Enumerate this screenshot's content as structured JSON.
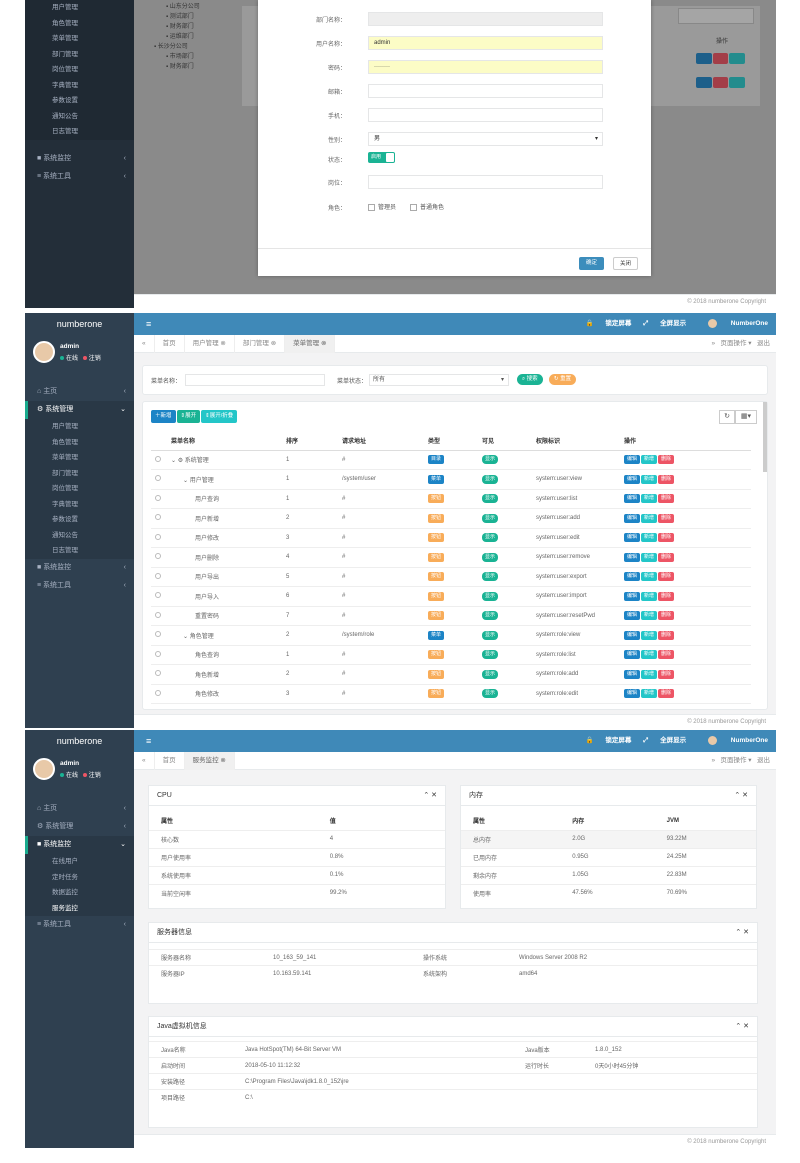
{
  "panel1": {
    "sidebar_items": [
      "用户管理",
      "角色管理",
      "菜单管理",
      "部门管理",
      "岗位管理",
      "字典管理",
      "参数设置",
      "通知公告",
      "日志管理"
    ],
    "nav": [
      {
        "label": "系统监控"
      },
      {
        "label": "系统工具"
      }
    ],
    "tree": [
      "山东分公司",
      "测试部门",
      "财务部门",
      "运维部门",
      "长沙分公司",
      "市场部门",
      "财务部门"
    ],
    "form": {
      "labels": [
        "部门名称：",
        "用户名称：",
        "密码：",
        "邮箱：",
        "手机：",
        "性别：",
        "状态：",
        "岗位：",
        "角色："
      ],
      "username_value": "admin",
      "password_value": "········",
      "gender_value": "男",
      "status_value": "启用",
      "role_options": [
        "管理员",
        "普通角色"
      ],
      "ok_label": "确定",
      "cancel_label": "关闭"
    },
    "toolbar_col": "操作",
    "footer": "© 2018 numberone Copyright"
  },
  "panel2": {
    "logo": "numberone",
    "top_links": [
      "锁定屏幕",
      "全屏显示",
      "NumberOne"
    ],
    "user": {
      "name": "admin",
      "status_online": "在线",
      "status_logout": "注销"
    },
    "nav": [
      {
        "label": "主页",
        "open": false
      },
      {
        "label": "系统管理",
        "open": true
      },
      {
        "label": "系统监控",
        "open": false
      },
      {
        "label": "系统工具",
        "open": false
      }
    ],
    "sub_items": [
      "用户管理",
      "角色管理",
      "菜单管理",
      "部门管理",
      "岗位管理",
      "字典管理",
      "参数设置",
      "通知公告",
      "日志管理"
    ],
    "tabs": [
      "首页",
      "用户管理",
      "部门管理",
      "菜单管理"
    ],
    "tab_right": [
      "页面操作",
      "退出"
    ],
    "search": {
      "name_label": "菜单名称：",
      "status_label": "菜单状态：",
      "status_value": "所有",
      "search_btn": "搜索",
      "reset_btn": "重置"
    },
    "actions": {
      "add": "新增",
      "expand": "展开",
      "collapse": "展开/折叠"
    },
    "columns": [
      "菜单名称",
      "排序",
      "请求地址",
      "类型",
      "可见",
      "权限标识",
      "操作"
    ],
    "rows": [
      {
        "name": "系统管理",
        "order": "1",
        "url": "#",
        "type": "目录",
        "visible": "显示",
        "perm": "",
        "level": 0
      },
      {
        "name": "用户管理",
        "order": "1",
        "url": "/system/user",
        "type": "菜单",
        "visible": "显示",
        "perm": "system:user:view",
        "level": 1
      },
      {
        "name": "用户查询",
        "order": "1",
        "url": "#",
        "type": "按钮",
        "visible": "显示",
        "perm": "system:user:list",
        "level": 2
      },
      {
        "name": "用户新增",
        "order": "2",
        "url": "#",
        "type": "按钮",
        "visible": "显示",
        "perm": "system:user:add",
        "level": 2
      },
      {
        "name": "用户修改",
        "order": "3",
        "url": "#",
        "type": "按钮",
        "visible": "显示",
        "perm": "system:user:edit",
        "level": 2
      },
      {
        "name": "用户删除",
        "order": "4",
        "url": "#",
        "type": "按钮",
        "visible": "显示",
        "perm": "system:user:remove",
        "level": 2
      },
      {
        "name": "用户导出",
        "order": "5",
        "url": "#",
        "type": "按钮",
        "visible": "显示",
        "perm": "system:user:export",
        "level": 2
      },
      {
        "name": "用户导入",
        "order": "6",
        "url": "#",
        "type": "按钮",
        "visible": "显示",
        "perm": "system:user:import",
        "level": 2
      },
      {
        "name": "重置密码",
        "order": "7",
        "url": "#",
        "type": "按钮",
        "visible": "显示",
        "perm": "system:user:resetPwd",
        "level": 2
      },
      {
        "name": "角色管理",
        "order": "2",
        "url": "/system/role",
        "type": "菜单",
        "visible": "显示",
        "perm": "system:role:view",
        "level": 1
      },
      {
        "name": "角色查询",
        "order": "1",
        "url": "#",
        "type": "按钮",
        "visible": "显示",
        "perm": "system:role:list",
        "level": 2
      },
      {
        "name": "角色新增",
        "order": "2",
        "url": "#",
        "type": "按钮",
        "visible": "显示",
        "perm": "system:role:add",
        "level": 2
      },
      {
        "name": "角色修改",
        "order": "3",
        "url": "#",
        "type": "按钮",
        "visible": "显示",
        "perm": "system:role:edit",
        "level": 2
      }
    ],
    "row_btns": [
      "编辑",
      "新增",
      "删除"
    ],
    "footer": "© 2018 numberone Copyright"
  },
  "panel3": {
    "logo": "numberone",
    "top_links": [
      "锁定屏幕",
      "全屏显示",
      "NumberOne"
    ],
    "user": {
      "name": "admin",
      "status_online": "在线",
      "status_logout": "注销"
    },
    "nav": [
      {
        "label": "主页",
        "open": false
      },
      {
        "label": "系统管理",
        "open": false
      },
      {
        "label": "系统监控",
        "open": true
      },
      {
        "label": "系统工具",
        "open": false
      }
    ],
    "sub_items": [
      "在线用户",
      "定时任务",
      "数据监控",
      "服务监控"
    ],
    "tabs": [
      "首页",
      "服务监控"
    ],
    "tab_right": [
      "页面操作",
      "退出"
    ],
    "cpu": {
      "title": "CPU",
      "cols": [
        "属性",
        "值"
      ],
      "rows": [
        [
          "核心数",
          "4"
        ],
        [
          "用户使用率",
          "0.8%"
        ],
        [
          "系统使用率",
          "0.1%"
        ],
        [
          "当前空闲率",
          "99.2%"
        ]
      ]
    },
    "mem": {
      "title": "内存",
      "cols": [
        "属性",
        "内存",
        "JVM"
      ],
      "rows": [
        [
          "总内存",
          "2.0G",
          "93.22M"
        ],
        [
          "已用内存",
          "0.95G",
          "24.25M"
        ],
        [
          "剩余内存",
          "1.05G",
          "22.83M"
        ],
        [
          "使用率",
          "47.56%",
          "70.69%"
        ]
      ]
    },
    "server": {
      "title": "服务器信息",
      "rows": [
        [
          "服务器名称",
          "10_163_59_141",
          "操作系统",
          "Windows Server 2008 R2"
        ],
        [
          "服务器IP",
          "10.163.59.141",
          "系统架构",
          "amd64"
        ]
      ]
    },
    "jvm": {
      "title": "Java虚拟机信息",
      "rows": [
        [
          "Java名称",
          "Java HotSpot(TM) 64-Bit Server VM",
          "Java版本",
          "1.8.0_152"
        ],
        [
          "启动时间",
          "2018-05-10 11:12:32",
          "运行时长",
          "0天0小时45分钟"
        ],
        [
          "安装路径",
          "C:\\Program Files\\Java\\jdk1.8.0_152\\jre",
          "",
          " "
        ],
        [
          "项目路径",
          "C:\\",
          "",
          ""
        ]
      ]
    },
    "footer": "© 2018 numberone Copyright"
  }
}
